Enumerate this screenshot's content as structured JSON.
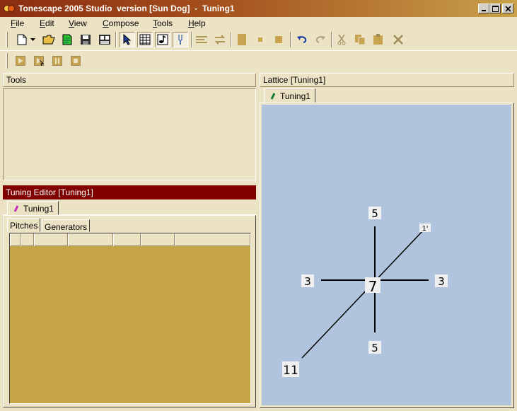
{
  "window": {
    "title": "Tonescape 2005 Studio  version [Sun Dog]  -  Tuning1"
  },
  "menu": {
    "items": [
      {
        "label": "File",
        "key": "F",
        "rest": "ile"
      },
      {
        "label": "Edit",
        "key": "E",
        "rest": "dit"
      },
      {
        "label": "View",
        "key": "V",
        "rest": "iew"
      },
      {
        "label": "Compose",
        "key": "C",
        "rest": "ompose"
      },
      {
        "label": "Tools",
        "key": "T",
        "rest": "ools"
      },
      {
        "label": "Help",
        "key": "H",
        "rest": "elp"
      }
    ]
  },
  "toolbar": {
    "row1": [
      "new-icon",
      "dropdown-arrow-icon",
      "open-folder-icon",
      "open-green-icon",
      "save-icon",
      "save-all-icon",
      "select-pointer-icon",
      "grid-icon",
      "note-icon",
      "tuning-fork-icon",
      "align-icon",
      "loop-icon",
      "block-icon",
      "small-square-icon",
      "square-icon",
      "undo-icon",
      "redo-icon",
      "cut-icon",
      "copy-icon",
      "paste-icon",
      "delete-icon"
    ],
    "row2": [
      "play-icon",
      "play-select-icon",
      "pause-icon",
      "stop-icon"
    ]
  },
  "tools_panel": {
    "title": "Tools"
  },
  "tuning_editor": {
    "title": "Tuning Editor  [Tuning1]",
    "doc_tab": "Tuning1",
    "sub_tabs": [
      "Pitches",
      "Generators"
    ],
    "grid_bg": "#c5a446"
  },
  "lattice": {
    "title": "Lattice  [Tuning1]",
    "doc_tab": "Tuning1",
    "bg_color": "#b0c4de",
    "nodes": {
      "center": "7",
      "top": "5",
      "bottom": "5",
      "left": "3",
      "right": "3",
      "upper_right": "1'",
      "lower_left": "11"
    }
  },
  "colors": {
    "title_bar_start": "#8b2d10",
    "panel_bg": "#ece2c4",
    "editor_header": "#800000"
  }
}
